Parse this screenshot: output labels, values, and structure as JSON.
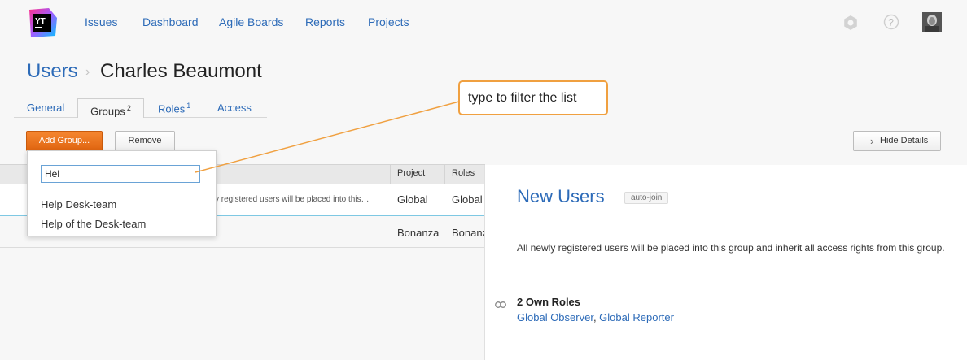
{
  "nav": {
    "items": [
      "Issues",
      "Dashboard",
      "Agile Boards",
      "Reports",
      "Projects"
    ]
  },
  "header": {
    "breadcrumb_root": "Users",
    "breadcrumb_sep": "›",
    "title": "Charles Beaumont"
  },
  "tabs": [
    {
      "label": "General",
      "count": ""
    },
    {
      "label": "Groups",
      "count": "2"
    },
    {
      "label": "Roles",
      "count": "1"
    },
    {
      "label": "Access",
      "count": ""
    }
  ],
  "toolbar": {
    "add_label": "Add Group...",
    "remove_label": "Remove",
    "hide_label": "Hide Details",
    "hide_chevron": "›"
  },
  "table": {
    "headers": {
      "project": "Project",
      "roles": "Roles"
    },
    "rows": [
      {
        "desc": "y registered users will be placed into this…",
        "project": "Global",
        "roles": "Global"
      },
      {
        "desc": "",
        "project": "Bonanza",
        "roles": "Bonanza"
      }
    ]
  },
  "dropdown": {
    "input_value": "Hel",
    "items": [
      "Help Desk-team",
      "Help of the Desk-team"
    ]
  },
  "details": {
    "title": "New Users",
    "badge": "auto-join",
    "description": "All newly registered users will be placed into this group and inherit all access rights from this group.",
    "roles_heading": "2 Own Roles",
    "roles": [
      "Global Observer",
      "Global Reporter"
    ],
    "roles_separator": ", "
  },
  "callout": {
    "text": "type to filter the list"
  },
  "colors": {
    "accent": "#e06510",
    "link": "#2d6bb8",
    "callout_border": "#f0a040"
  },
  "icons": [
    "youtrack-logo",
    "settings-icon",
    "help-icon",
    "avatar",
    "roles-icon"
  ]
}
